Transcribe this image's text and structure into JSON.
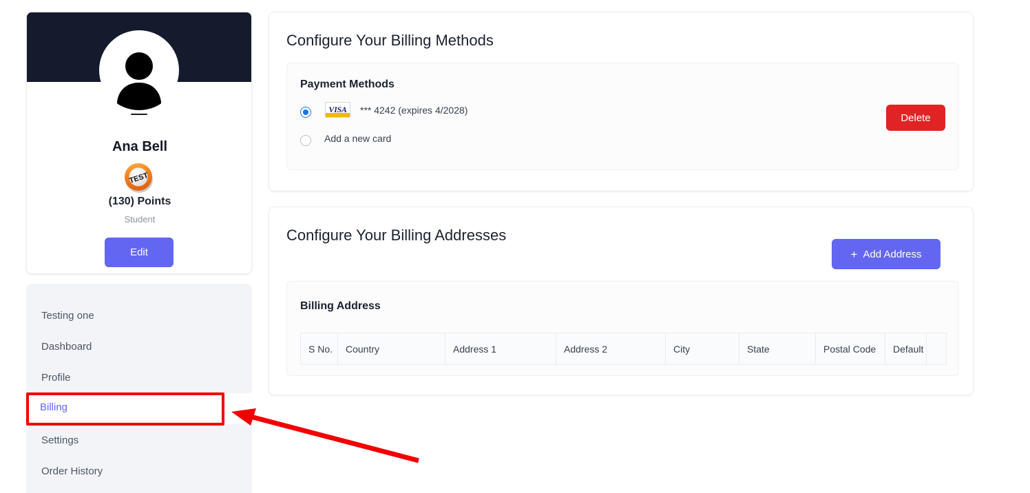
{
  "profile": {
    "avatar_icon": "person-avatar-icon",
    "name": "Ana Bell",
    "badge_icon": "test-badge-icon",
    "badge_text": "TEST",
    "points": "(130) Points",
    "role": "Student",
    "edit_label": "Edit"
  },
  "sidebar": {
    "items": [
      {
        "label": "Testing one",
        "active": false
      },
      {
        "label": "Dashboard",
        "active": false
      },
      {
        "label": "Profile",
        "active": false
      },
      {
        "label": "Billing",
        "active": true
      },
      {
        "label": "Settings",
        "active": false
      },
      {
        "label": "Order History",
        "active": false
      }
    ]
  },
  "billing_methods": {
    "title": "Configure Your Billing Methods",
    "section_heading": "Payment Methods",
    "options": [
      {
        "selected": true,
        "brand_icon": "visa-card-icon",
        "brand_text": "VISA",
        "label": "*** 4242  (expires 4/2028)"
      },
      {
        "selected": false,
        "brand_icon": "",
        "brand_text": "",
        "label": "Add a new card"
      }
    ],
    "delete_label": "Delete"
  },
  "billing_addresses": {
    "title": "Configure Your Billing Addresses",
    "add_button_label": "Add Address",
    "add_button_icon": "plus-icon",
    "section_heading": "Billing Address",
    "table": {
      "columns": [
        "S No.",
        "Country",
        "Address 1",
        "Address 2",
        "City",
        "State",
        "Postal Code",
        "Default",
        ""
      ],
      "rows": []
    }
  },
  "annotations": {
    "highlight_target": "Billing",
    "arrow_icon": "red-arrow-pointer",
    "highlight_color": "#f20000"
  }
}
